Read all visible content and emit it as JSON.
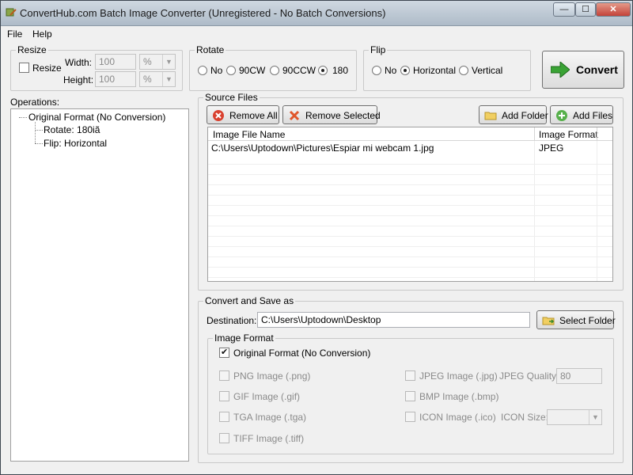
{
  "window": {
    "title": "ConvertHub.com Batch Image Converter (Unregistered - No Batch Conversions)"
  },
  "controls": {
    "minimize": "—",
    "maximize": "☐",
    "close": "✕"
  },
  "menu": {
    "items": [
      "File",
      "Help"
    ]
  },
  "resize": {
    "group_label": "Resize",
    "checkbox_label": "Resize",
    "width_label": "Width:",
    "height_label": "Height:",
    "width_value": "100",
    "height_value": "100",
    "width_unit": "%",
    "height_unit": "%"
  },
  "rotate": {
    "group_label": "Rotate",
    "options": [
      "No",
      "90CW",
      "90CCW",
      "180"
    ],
    "selected": "180"
  },
  "flip": {
    "group_label": "Flip",
    "options": [
      "No",
      "Horizontal",
      "Vertical"
    ],
    "selected": "Horizontal"
  },
  "convert_button": "Convert",
  "operations": {
    "label": "Operations:",
    "root": "Original Format (No Conversion)",
    "children": [
      "Rotate: 180iã",
      "Flip: Horizontal"
    ]
  },
  "source_files": {
    "group_label": "Source Files",
    "remove_all": "Remove All",
    "remove_selected": "Remove Selected",
    "add_folder": "Add Folder",
    "add_files": "Add Files",
    "columns": [
      "Image File Name",
      "Image Format"
    ],
    "rows": [
      {
        "name": "C:\\Users\\Uptodown\\Pictures\\Espiar mi webcam 1.jpg",
        "format": "JPEG"
      }
    ]
  },
  "convert_save": {
    "group_label": "Convert and Save as",
    "destination_label": "Destination:",
    "destination_value": "C:\\Users\\Uptodown\\Desktop",
    "select_folder": "Select Folder"
  },
  "image_format": {
    "group_label": "Image Format",
    "original": "Original Format (No Conversion)",
    "png": "PNG Image (.png)",
    "gif": "GIF Image (.gif)",
    "tga": "TGA Image (.tga)",
    "tiff": "TIFF Image (.tiff)",
    "jpeg": "JPEG Image (.jpg)",
    "bmp": "BMP Image (.bmp)",
    "icon": "ICON Image (.ico)",
    "jpeg_quality_label": "JPEG Quality:",
    "jpeg_quality_value": "80",
    "icon_size_label": "ICON Size:"
  }
}
